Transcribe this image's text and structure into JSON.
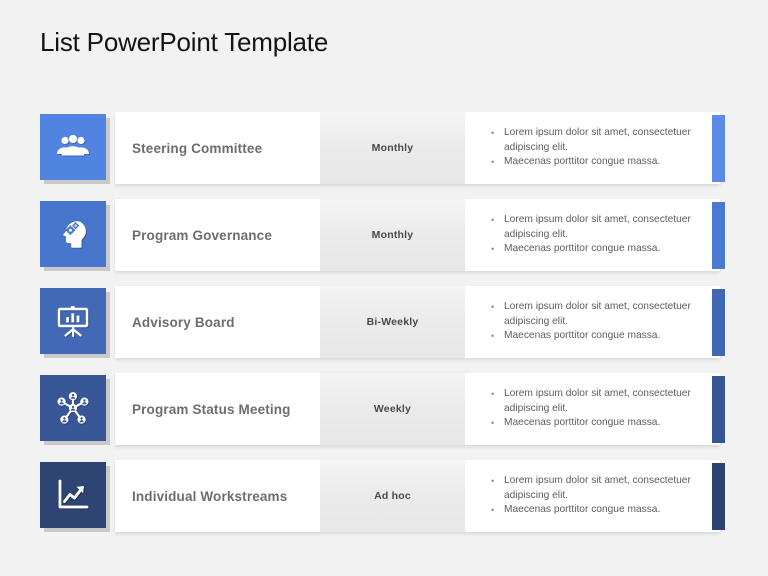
{
  "title": "List PowerPoint Template",
  "theme": {
    "background": "#f2f2f2",
    "band_background": "#ffffff",
    "frequency_background": "#ededed",
    "title_color": "#141414",
    "label_color": "#6d6d6d",
    "frequency_color": "#494949",
    "bullet_color": "#5d5d5d"
  },
  "rows": [
    {
      "icon": "group-of-people-icon",
      "label": "Steering Committee",
      "frequency": "Monthly",
      "bullets": [
        "Lorem ipsum dolor sit amet, consectetuer adipiscing elit.",
        "Maecenas porttitor congue massa."
      ],
      "tile_color": "#5183e0",
      "accent_color": "#5c8ae8"
    },
    {
      "icon": "head-with-gears-icon",
      "label": "Program Governance",
      "frequency": "Monthly",
      "bullets": [
        "Lorem ipsum dolor sit amet, consectetuer adipiscing elit.",
        "Maecenas porttitor congue massa."
      ],
      "tile_color": "#4876cc",
      "accent_color": "#4a79d0"
    },
    {
      "icon": "presentation-board-icon",
      "label": "Advisory Board",
      "frequency": "Bi-Weekly",
      "bullets": [
        "Lorem ipsum dolor sit amet, consectetuer adipiscing elit.",
        "Maecenas porttitor congue massa."
      ],
      "tile_color": "#4169b5",
      "accent_color": "#3f67b4"
    },
    {
      "icon": "network-hub-icon",
      "label": "Program Status Meeting",
      "frequency": "Weekly",
      "bullets": [
        "Lorem ipsum dolor sit amet, consectetuer adipiscing elit.",
        "Maecenas porttitor congue massa."
      ],
      "tile_color": "#375796",
      "accent_color": "#355593"
    },
    {
      "icon": "growth-line-chart-icon",
      "label": "Individual Workstreams",
      "frequency": "Ad hoc",
      "bullets": [
        "Lorem ipsum dolor sit amet, consectetuer adipiscing elit.",
        "Maecenas porttitor congue massa."
      ],
      "tile_color": "#2e4473",
      "accent_color": "#2c4270"
    }
  ]
}
